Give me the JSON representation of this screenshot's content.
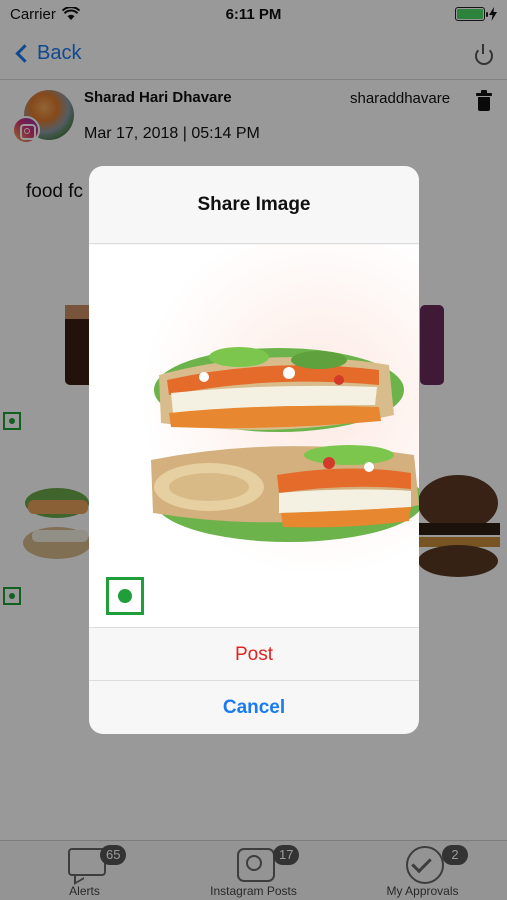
{
  "status_bar": {
    "carrier": "Carrier",
    "time": "6:11 PM"
  },
  "nav": {
    "back_label": "Back"
  },
  "post": {
    "author": "Sharad Hari Dhavare",
    "handle": "sharaddhavare",
    "date": "Mar 17, 2018 | 05:14 PM",
    "caption": "food fc"
  },
  "modal": {
    "title": "Share Image",
    "post_label": "Post",
    "cancel_label": "Cancel"
  },
  "tabs": [
    {
      "label": "Alerts",
      "badge": "65",
      "icon": "chat-icon"
    },
    {
      "label": "Instagram Posts",
      "badge": "17",
      "icon": "camera-icon"
    },
    {
      "label": "My Approvals",
      "badge": "2",
      "icon": "check-circle-icon"
    }
  ],
  "colors": {
    "accent_blue": "#1a7bf0",
    "destructive_red": "#e02424",
    "check_green": "#1f9e3a",
    "battery_green": "#4cd964"
  }
}
